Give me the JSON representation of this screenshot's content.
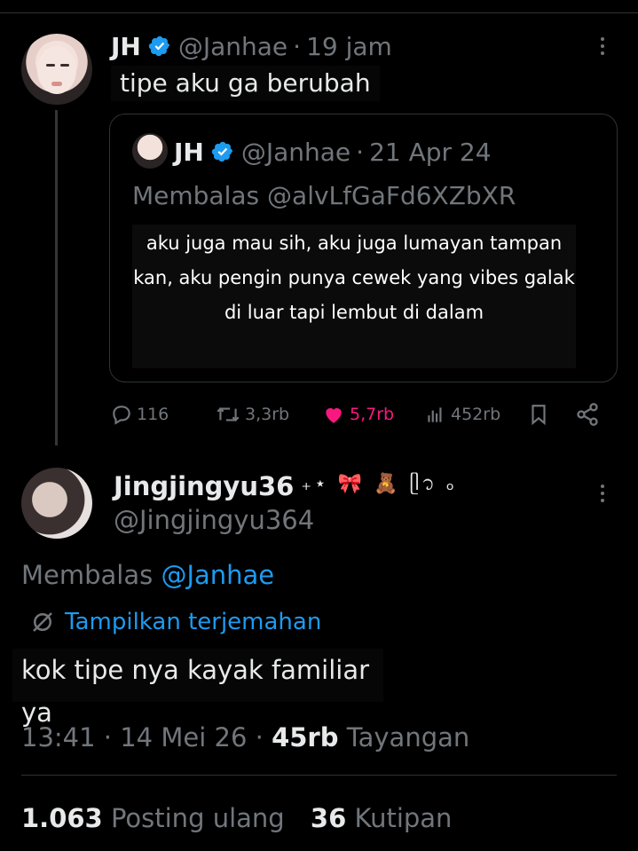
{
  "tweet": {
    "display_name": "JH",
    "handle": "@Janhae",
    "separator": "·",
    "time": "19 jam",
    "text": "tipe aku ga berubah"
  },
  "quote": {
    "display_name": "JH",
    "handle": "@Janhae",
    "separator": "·",
    "date": "21 Apr 24",
    "reply_prefix": "Membalas",
    "reply_to": "@alvLfGaFd6XZbXR",
    "text": "aku juga mau sih, aku juga lumayan tampan kan, aku pengin punya cewek yang vibes galak di luar tapi lembut di dalam"
  },
  "actions": {
    "replies": "116",
    "reposts": "3,3rb",
    "likes": "5,7rb",
    "views": "452rb"
  },
  "reply_tweet": {
    "display_name": "Jingjingyu36",
    "name_emojis": "₊⋆ 🎀 🧸 ᥫ᭡ ₒ",
    "handle": "@Jingjingyu364",
    "replying_prefix": "Membalas",
    "replying_to": "@Janhae",
    "translate_label": "Tampilkan terjemahan",
    "text": "kok tipe nya kayak familiar ya",
    "time": "13:41",
    "separator": "·",
    "date": "14 Mei 26",
    "views_count": "45rb",
    "views_label": "Tayangan",
    "reposts_count": "1.063",
    "reposts_label": "Posting ulang",
    "quotes_count": "36",
    "quotes_label": "Kutipan"
  },
  "colors": {
    "background": "#000000",
    "text": "#e7e9ea",
    "muted": "#71767b",
    "accent": "#1d9bf0",
    "like": "#f91880"
  }
}
